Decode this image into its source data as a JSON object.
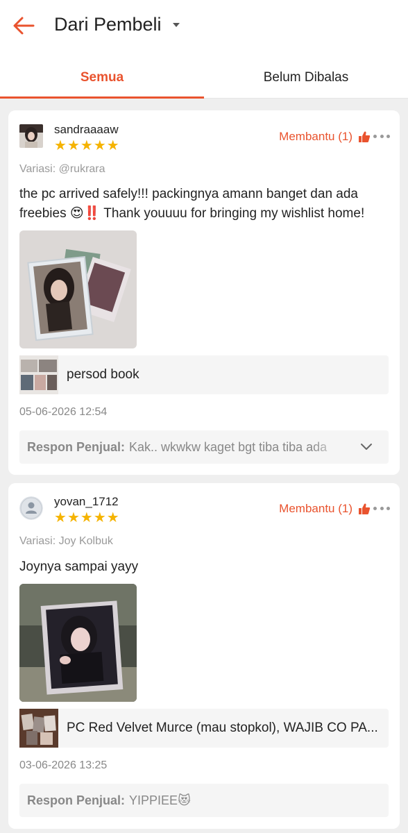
{
  "header": {
    "title": "Dari Pembeli",
    "back_icon": "back-arrow-icon",
    "dropdown_icon": "caret-down-icon",
    "accent": "#e9532e"
  },
  "tabs": [
    {
      "label": "Semua",
      "active": true
    },
    {
      "label": "Belum Dibalas",
      "active": false
    }
  ],
  "reviews": [
    {
      "username": "sandraaaaw",
      "rating": 5,
      "star_glyph": "★",
      "helpful_label": "Membantu (1)",
      "variation": "Variasi: @rukrara",
      "comment": "the pc arrived safely!!! packingnya amann banget dan ada freebies 😍‼️ Thank youuuu for bringing my wishlist home!",
      "product_name": "persod book",
      "timestamp": "05-06-2026 12:54",
      "response_label": "Respon Penjual:",
      "response_text": "Kak.. wkwkw kaget bgt tiba tiba ada"
    },
    {
      "username": "yovan_1712",
      "rating": 5,
      "star_glyph": "★",
      "helpful_label": "Membantu (1)",
      "variation": "Variasi: Joy Kolbuk",
      "comment": "Joynya sampai yayy",
      "product_name": "PC Red Velvet Murce (mau stopkol), WAJIB CO PA...",
      "timestamp": "03-06-2026 13:25",
      "response_label": "Respon Penjual:",
      "response_text": "YIPPIEE😻"
    }
  ]
}
